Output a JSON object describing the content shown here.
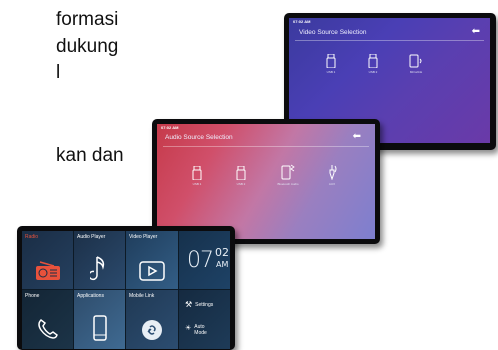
{
  "side_text": {
    "line1": "formasi",
    "line2": "dukung",
    "line3": "l",
    "line4": "kan dan"
  },
  "video_screen": {
    "time": "07:02 AM",
    "title": "Video Source Selection",
    "back_icon": "back-arrow-icon",
    "sources": [
      {
        "label": "USB 1",
        "icon": "usb-icon"
      },
      {
        "label": "USB 2",
        "icon": "usb-icon"
      },
      {
        "label": "Mirrorlink",
        "icon": "phone-icon"
      }
    ]
  },
  "audio_screen": {
    "time": "07:02 AM",
    "title": "Audio Source Selection",
    "back_icon": "back-arrow-icon",
    "sources": [
      {
        "label": "USB 1",
        "icon": "usb-icon"
      },
      {
        "label": "USB 2",
        "icon": "usb-icon"
      },
      {
        "label": "Bluetooth Audio",
        "icon": "bluetooth-phone-icon"
      },
      {
        "label": "AUX",
        "icon": "aux-jack-icon"
      }
    ]
  },
  "home_screen": {
    "tiles": {
      "radio": "Radio",
      "audio_player": "Audio Player",
      "video_player": "Video Player",
      "phone": "Phone",
      "applications": "Applications",
      "mobile_link": "Mobile Link",
      "settings": "Settings",
      "auto_mode_1": "Auto",
      "auto_mode_2": "Mode"
    },
    "clock": {
      "hour": "07",
      "minute": "02",
      "ampm": "AM"
    }
  },
  "colors": {
    "radio_accent": "#e8523c",
    "video_bg": "#4a3fb5",
    "audio_bg": "#c63a4a",
    "home_bg": "#1c3448"
  }
}
